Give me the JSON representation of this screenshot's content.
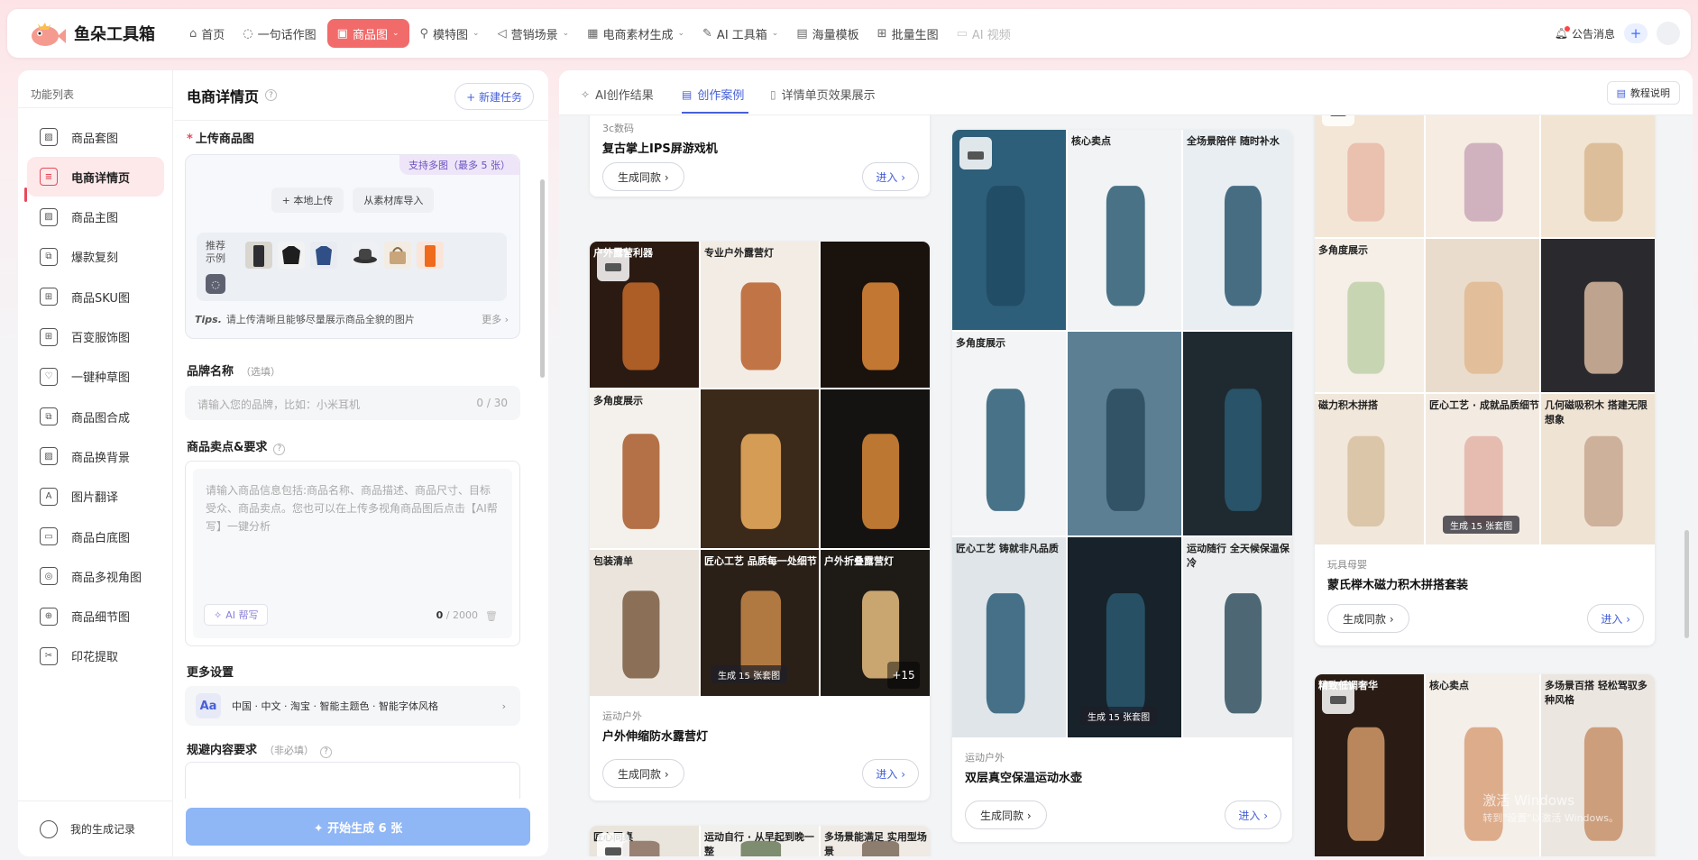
{
  "app": {
    "name": "鱼朵工具箱"
  },
  "topnav": {
    "items": [
      {
        "label": "首页",
        "icon": "home-icon",
        "glyph": "⌂",
        "dropdown": false
      },
      {
        "label": "一句话作图",
        "icon": "chat-icon",
        "glyph": "◌",
        "dropdown": false
      },
      {
        "label": "商品图",
        "icon": "box-icon",
        "glyph": "▣",
        "dropdown": true,
        "active": true
      },
      {
        "label": "模特图",
        "icon": "person-icon",
        "glyph": "⚲",
        "dropdown": true
      },
      {
        "label": "营销场景",
        "icon": "megaphone-icon",
        "glyph": "◁",
        "dropdown": true
      },
      {
        "label": "电商素材生成",
        "icon": "grid-icon",
        "glyph": "▦",
        "dropdown": true
      },
      {
        "label": "AI 工具箱",
        "icon": "pen-icon",
        "glyph": "✎",
        "dropdown": true
      },
      {
        "label": "海量模板",
        "icon": "template-icon",
        "glyph": "▤",
        "dropdown": false
      },
      {
        "label": "批量生图",
        "icon": "batch-icon",
        "glyph": "⊞",
        "dropdown": false
      },
      {
        "label": "AI 视频",
        "icon": "video-icon",
        "glyph": "▭",
        "dropdown": false,
        "disabled": true
      }
    ],
    "notice": "公告消息",
    "plus": "+"
  },
  "funcnav": {
    "title": "功能列表",
    "items": [
      {
        "label": "商品套图",
        "icon": "image-icon",
        "glyph": "▨"
      },
      {
        "label": "电商详情页",
        "icon": "document-icon",
        "glyph": "≡",
        "active": true
      },
      {
        "label": "商品主图",
        "icon": "picture-icon",
        "glyph": "▨"
      },
      {
        "label": "爆款复刻",
        "icon": "copy-icon",
        "glyph": "⧉"
      },
      {
        "label": "商品SKU图",
        "icon": "sku-grid-icon",
        "glyph": "⊞"
      },
      {
        "label": "百变服饰图",
        "icon": "apps-icon",
        "glyph": "⊞"
      },
      {
        "label": "一键种草图",
        "icon": "heart-icon",
        "glyph": "♡"
      },
      {
        "label": "商品图合成",
        "icon": "merge-icon",
        "glyph": "⧉"
      },
      {
        "label": "商品换背景",
        "icon": "background-icon",
        "glyph": "▨"
      },
      {
        "label": "图片翻译",
        "icon": "translate-icon",
        "glyph": "A"
      },
      {
        "label": "商品白底图",
        "icon": "white-bg-icon",
        "glyph": "▭"
      },
      {
        "label": "商品多视角图",
        "icon": "globe-icon",
        "glyph": "◎"
      },
      {
        "label": "商品细节图",
        "icon": "zoom-icon",
        "glyph": "⊕"
      },
      {
        "label": "印花提取",
        "icon": "extract-icon",
        "glyph": "✂"
      }
    ],
    "history": "我的生成记录"
  },
  "form": {
    "title": "电商详情页",
    "new_task": "+ 新建任务",
    "upload": {
      "label": "上传商品图",
      "multi_badge": "支持多图（最多 5 张）",
      "local_upload": "+ 本地上传",
      "library_import": "从素材库导入",
      "sample_label": "推荐\n示例",
      "tips_prefix": "Tips.",
      "tips": "请上传清晰且能够尽量展示商品全貌的图片",
      "more": "更多 ›"
    },
    "brand": {
      "label": "品牌名称",
      "optional": "（选填）",
      "placeholder": "请输入您的品牌，比如：小米耳机",
      "count": "0 / 30"
    },
    "selling": {
      "label": "商品卖点&要求",
      "placeholder": "请输入商品信息包括:商品名称、商品描述、商品尺寸、目标受众、商品卖点。您也可以在上传多视角商品图后点击【AI帮写】一键分析",
      "ai_write": "AI 帮写",
      "count_current": "0",
      "count_max": " / 2000"
    },
    "more_settings": {
      "label": "更多设置",
      "aa": "Aa",
      "value": "中国 · 中文 · 淘宝 · 智能主题色 · 智能字体风格"
    },
    "avoid": {
      "label": "规避内容要求",
      "optional": "（非必填）"
    },
    "generate": "✦ 开始生成 6 张"
  },
  "right": {
    "tabs": [
      {
        "label": "AI创作结果",
        "icon": "ai-icon",
        "glyph": "✧"
      },
      {
        "label": "创作案例",
        "icon": "case-icon",
        "glyph": "▤",
        "active": true
      },
      {
        "label": "详情单页效果展示",
        "icon": "detail-icon",
        "glyph": "▯"
      }
    ],
    "tutorial": "教程说明",
    "cards": {
      "console": {
        "category": "3c数码",
        "title": "复古掌上IPS屏游戏机",
        "gen": "生成同款 ›",
        "enter": "进入 ›"
      },
      "lamp": {
        "category": "运动户外",
        "title": "户外伸缩防水露营灯",
        "gen": "生成同款 ›",
        "enter": "进入 ›",
        "badge": "生成 15 张套图",
        "plus": "+15",
        "cells": [
          "户外露营利器",
          "专业户外露营灯",
          "",
          "多角度展示",
          "",
          "",
          "包装清单",
          "匠心工艺 品质每一处细节",
          "户外折叠露营灯"
        ]
      },
      "bottle": {
        "category": "运动户外",
        "title": "双层真空保温运动水壶",
        "gen": "生成同款 ›",
        "enter": "进入 ›",
        "badge": "生成 15 张套图",
        "cells": [
          "",
          "核心卖点",
          "全场景陪伴 随时补水",
          "多角度展示",
          "",
          "",
          "匠心工艺 铸就非凡品质",
          "",
          "运动随行 全天候保温保冷"
        ]
      },
      "blocks": {
        "category": "玩具母婴",
        "title": "蒙氏榉木磁力积木拼搭套装",
        "gen": "生成同款 ›",
        "enter": "进入 ›",
        "badge": "生成 15 张套图",
        "cells": [
          "",
          "",
          "",
          "多角度展示",
          "",
          "",
          "磁力积木拼搭",
          "匠心工艺 · 成就品质细节",
          "几何磁吸积木 搭建无限想象"
        ]
      },
      "bracelet": {
        "cells": [
          "精致低调奢华",
          "核心卖点",
          "多场景百搭 轻松驾驭多种风格"
        ]
      },
      "partial": {
        "cells": [
          "匠心同桌",
          "运动自行 · 从早起到晚一整",
          "多场景能满足 实用型场景"
        ]
      }
    },
    "watermark_line1": "激活 Windows",
    "watermark_line2": "转到\"设置\"以激活 Windows。"
  },
  "colors": {
    "accent": "#f26b6b",
    "primary_blue": "#4660d8",
    "generate_button": "#8fb6f5"
  }
}
